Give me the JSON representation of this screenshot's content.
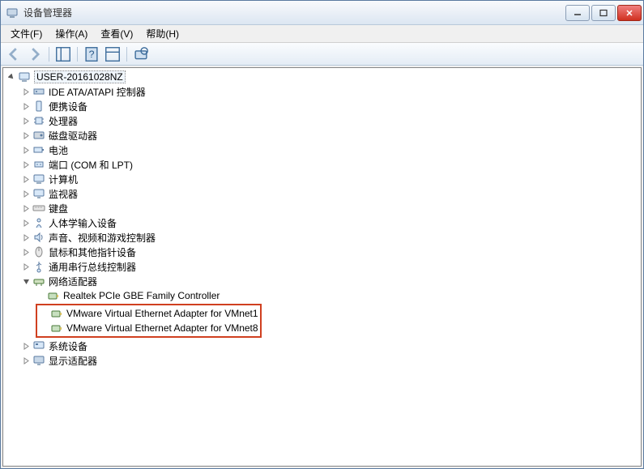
{
  "window": {
    "title": "设备管理器"
  },
  "menu": {
    "file": "文件(F)",
    "action": "操作(A)",
    "view": "查看(V)",
    "help": "帮助(H)"
  },
  "tree": {
    "root": "USER-20161028NZ",
    "items": [
      {
        "label": "IDE ATA/ATAPI 控制器",
        "icon": "ide"
      },
      {
        "label": "便携设备",
        "icon": "portable"
      },
      {
        "label": "处理器",
        "icon": "cpu"
      },
      {
        "label": "磁盘驱动器",
        "icon": "disk"
      },
      {
        "label": "电池",
        "icon": "battery"
      },
      {
        "label": "端口 (COM 和 LPT)",
        "icon": "port"
      },
      {
        "label": "计算机",
        "icon": "computer"
      },
      {
        "label": "监视器",
        "icon": "monitor"
      },
      {
        "label": "键盘",
        "icon": "keyboard"
      },
      {
        "label": "人体学输入设备",
        "icon": "hid"
      },
      {
        "label": "声音、视频和游戏控制器",
        "icon": "sound"
      },
      {
        "label": "鼠标和其他指针设备",
        "icon": "mouse"
      },
      {
        "label": "通用串行总线控制器",
        "icon": "usb"
      }
    ],
    "network": {
      "label": "网络适配器",
      "children": [
        {
          "label": "Realtek PCIe GBE Family Controller"
        },
        {
          "label": "VMware Virtual Ethernet Adapter for VMnet1",
          "highlighted": true
        },
        {
          "label": "VMware Virtual Ethernet Adapter for VMnet8",
          "highlighted": true
        }
      ]
    },
    "after_network": [
      {
        "label": "系统设备",
        "icon": "system"
      },
      {
        "label": "显示适配器",
        "icon": "display"
      }
    ]
  }
}
